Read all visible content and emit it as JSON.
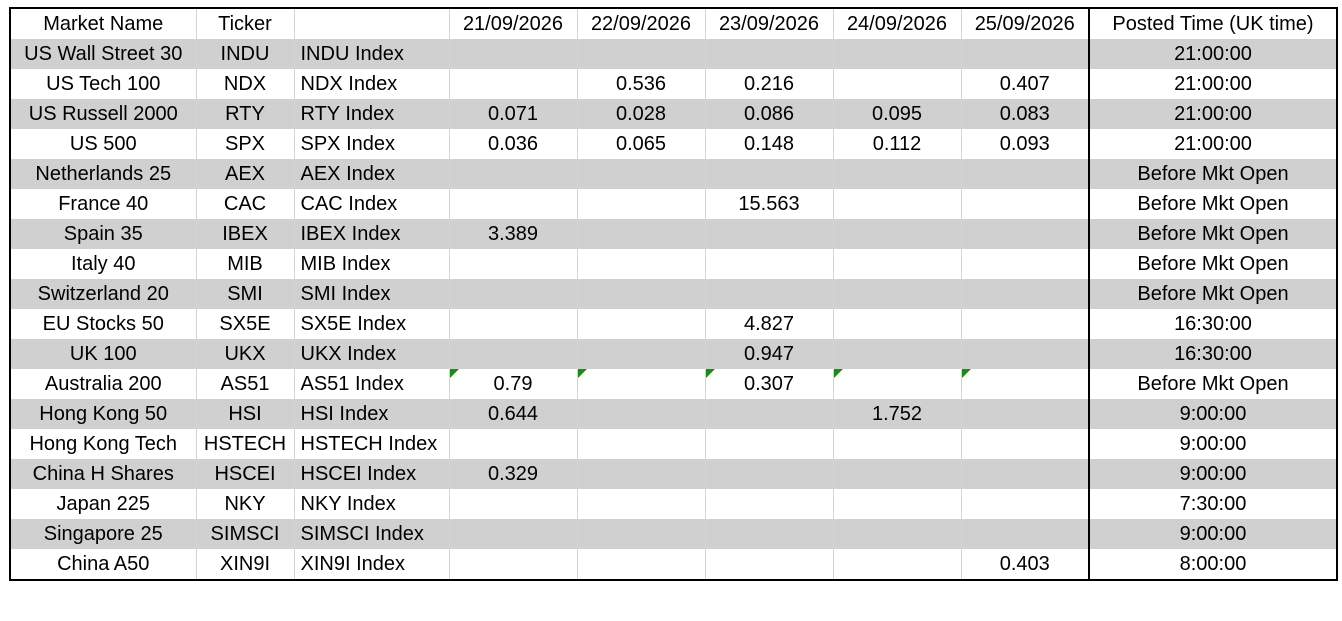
{
  "header": {
    "market_name": "Market Name",
    "ticker": "Ticker",
    "index": "",
    "dates": [
      "21/09/2026",
      "22/09/2026",
      "23/09/2026",
      "24/09/2026",
      "25/09/2026"
    ],
    "posted_time": "Posted Time (UK time)"
  },
  "rows": [
    {
      "market": "US Wall Street 30",
      "ticker": "INDU",
      "index": "INDU  Index",
      "values": [
        "",
        "",
        "",
        "",
        ""
      ],
      "posted": "21:00:00"
    },
    {
      "market": "US Tech 100",
      "ticker": "NDX",
      "index": "NDX Index",
      "values": [
        "",
        "0.536",
        "0.216",
        "",
        "0.407"
      ],
      "posted": "21:00:00"
    },
    {
      "market": "US Russell 2000",
      "ticker": "RTY",
      "index": "RTY Index",
      "values": [
        "0.071",
        "0.028",
        "0.086",
        "0.095",
        "0.083"
      ],
      "posted": "21:00:00"
    },
    {
      "market": "US 500",
      "ticker": "SPX",
      "index": "SPX Index",
      "values": [
        "0.036",
        "0.065",
        "0.148",
        "0.112",
        "0.093"
      ],
      "posted": "21:00:00"
    },
    {
      "market": "Netherlands 25",
      "ticker": "AEX",
      "index": "AEX Index",
      "values": [
        "",
        "",
        "",
        "",
        ""
      ],
      "posted": "Before Mkt Open"
    },
    {
      "market": "France 40",
      "ticker": "CAC",
      "index": "CAC Index",
      "values": [
        "",
        "",
        "15.563",
        "",
        ""
      ],
      "posted": "Before Mkt Open"
    },
    {
      "market": "Spain 35",
      "ticker": "IBEX",
      "index": "IBEX Index",
      "values": [
        "3.389",
        "",
        "",
        "",
        ""
      ],
      "posted": "Before Mkt Open"
    },
    {
      "market": "Italy 40",
      "ticker": "MIB",
      "index": "MIB Index",
      "values": [
        "",
        "",
        "",
        "",
        ""
      ],
      "posted": "Before Mkt Open"
    },
    {
      "market": "Switzerland 20",
      "ticker": "SMI",
      "index": "SMI Index",
      "values": [
        "",
        "",
        "",
        "",
        ""
      ],
      "posted": "Before Mkt Open"
    },
    {
      "market": "EU Stocks 50",
      "ticker": "SX5E",
      "index": "SX5E Index",
      "values": [
        "",
        "",
        "4.827",
        "",
        ""
      ],
      "posted": "16:30:00"
    },
    {
      "market": "UK 100",
      "ticker": "UKX",
      "index": "UKX Index",
      "values": [
        "",
        "",
        "0.947",
        "",
        ""
      ],
      "posted": "16:30:00"
    },
    {
      "market": "Australia 200",
      "ticker": "AS51",
      "index": "AS51 Index",
      "values": [
        "0.79",
        "",
        "0.307",
        "",
        ""
      ],
      "posted": "Before Mkt Open",
      "flagged": true
    },
    {
      "market": "Hong Kong 50",
      "ticker": "HSI",
      "index": "HSI Index",
      "values": [
        "0.644",
        "",
        "",
        "1.752",
        ""
      ],
      "posted": "9:00:00"
    },
    {
      "market": "Hong Kong Tech",
      "ticker": "HSTECH",
      "index": "HSTECH Index",
      "values": [
        "",
        "",
        "",
        "",
        ""
      ],
      "posted": "9:00:00"
    },
    {
      "market": "China H Shares",
      "ticker": "HSCEI",
      "index": "HSCEI Index",
      "values": [
        "0.329",
        "",
        "",
        "",
        ""
      ],
      "posted": "9:00:00"
    },
    {
      "market": "Japan 225",
      "ticker": "NKY",
      "index": "NKY Index",
      "values": [
        "",
        "",
        "",
        "",
        ""
      ],
      "posted": "7:30:00"
    },
    {
      "market": "Singapore 25",
      "ticker": "SIMSCI",
      "index": "SIMSCI Index",
      "values": [
        "",
        "",
        "",
        "",
        ""
      ],
      "posted": "9:00:00"
    },
    {
      "market": "China A50",
      "ticker": "XIN9I",
      "index": "XIN9I Index",
      "values": [
        "",
        "",
        "",
        "",
        "0.403"
      ],
      "posted": "8:00:00"
    }
  ],
  "colors": {
    "band": "#d0d0d0",
    "flag": "#1a8a1a",
    "border": "#000000"
  }
}
